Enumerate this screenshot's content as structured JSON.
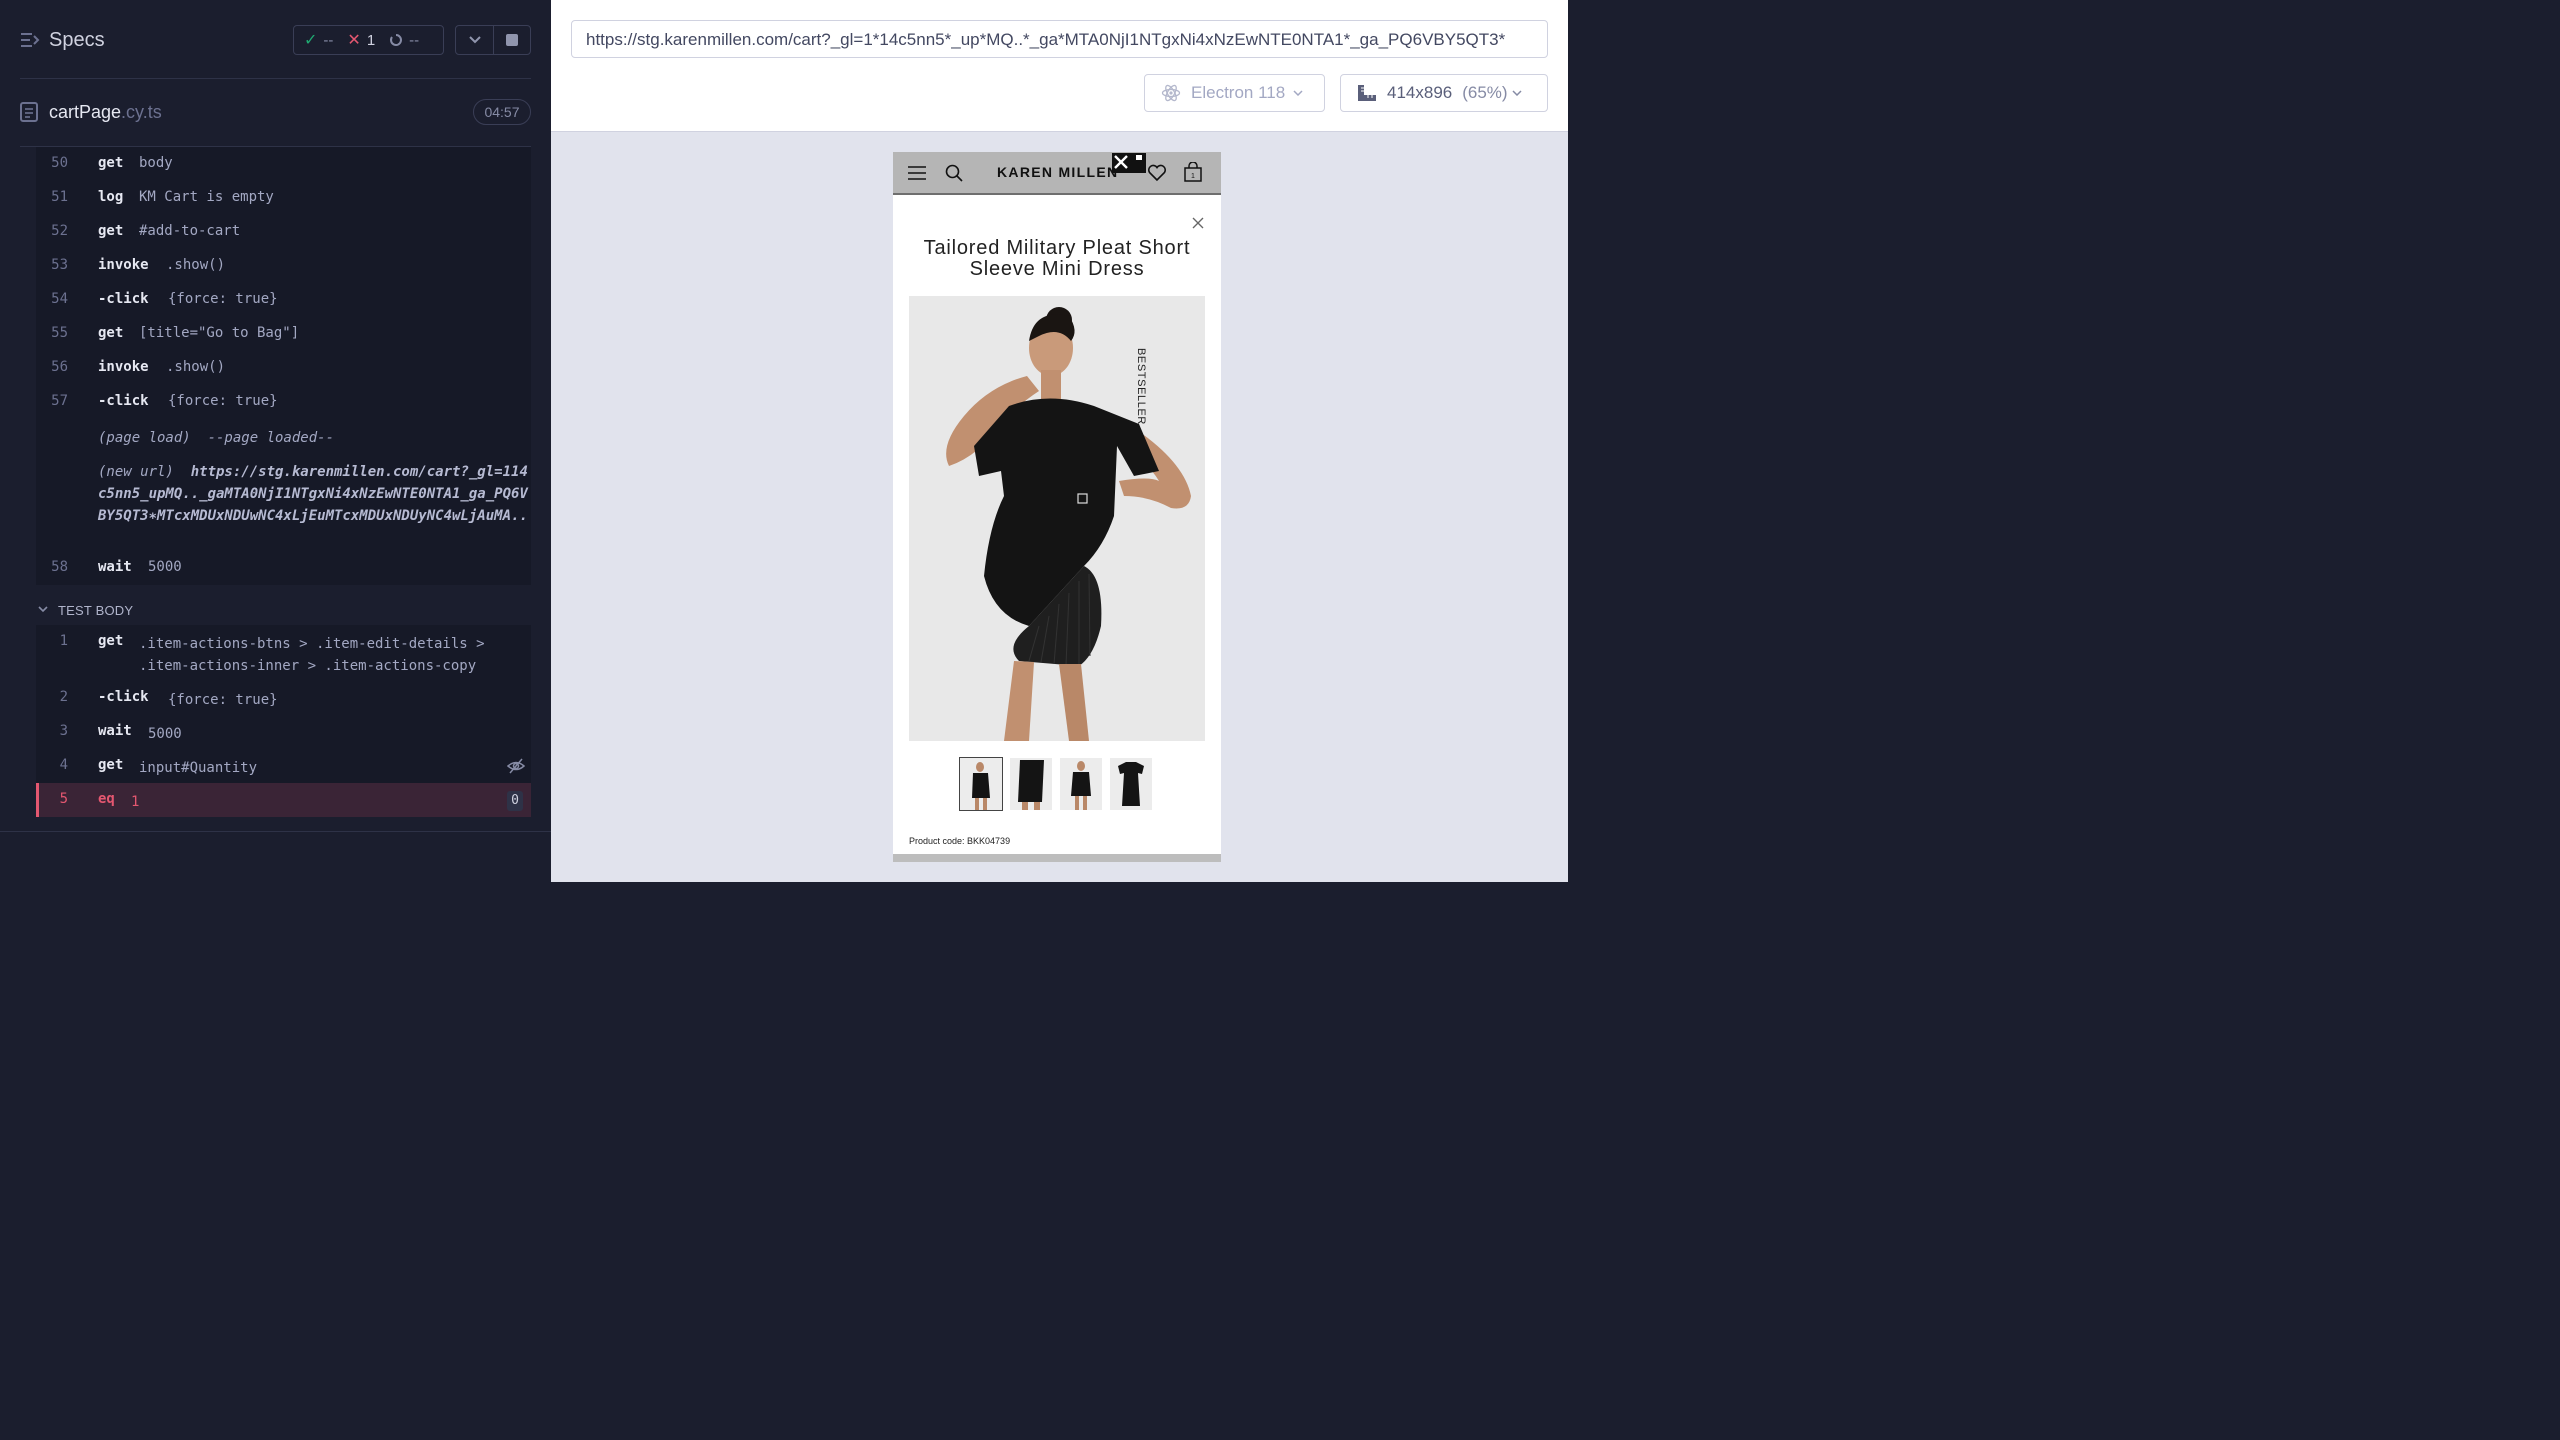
{
  "specs": {
    "title": "Specs",
    "passed": "--",
    "failed": "1",
    "pending": "--"
  },
  "file": {
    "name": "cartPage",
    "ext": ".cy.ts",
    "duration": "04:57"
  },
  "commands": [
    {
      "num": "50",
      "name": "get",
      "msg": "body"
    },
    {
      "num": "51",
      "name": "log",
      "msg": "KM Cart is empty"
    },
    {
      "num": "52",
      "name": "get",
      "msg": "#add-to-cart"
    },
    {
      "num": "53",
      "name": "invoke",
      "msg": ".show()"
    },
    {
      "num": "54",
      "name": "-click",
      "msg": "{force: true}"
    },
    {
      "num": "55",
      "name": "get",
      "msg": "[title=\"Go to Bag\"]"
    },
    {
      "num": "56",
      "name": "invoke",
      "msg": ".show()"
    },
    {
      "num": "57",
      "name": "-click",
      "msg": "{force: true}"
    }
  ],
  "page_load": {
    "label": "(page load)",
    "msg": "--page loaded--"
  },
  "new_url": {
    "label": "(new url)",
    "msg": "https://stg.karenmillen.com/cart?_gl=114c5nn5_upMQ.._gaMTA0NjI1NTgxNi4xNzEwNTE0NTA1_ga_PQ6VBY5QT3∗MTcxMDUxNDUwNC4xLjEuMTcxMDUxNDUyNC4wLjAuMA.."
  },
  "command_58": {
    "num": "58",
    "name": "wait",
    "msg": "5000"
  },
  "test_body": {
    "label": "TEST BODY",
    "commands": [
      {
        "num": "1",
        "name": "get",
        "msg": ".item-actions-btns > .item-edit-details > .item-actions-inner > .item-actions-copy"
      },
      {
        "num": "2",
        "name": "-click",
        "msg": "{force: true}"
      },
      {
        "num": "3",
        "name": "wait",
        "msg": "5000"
      },
      {
        "num": "4",
        "name": "get",
        "msg": "input#Quantity"
      },
      {
        "num": "5",
        "name": "eq",
        "msg": "1",
        "count": "0"
      }
    ]
  },
  "browser": {
    "url": "https://stg.karenmillen.com/cart?_gl=1*14c5nn5*_up*MQ..*_ga*MTA0NjI1NTgxNi4xNzEwNTE0NTA1*_ga_PQ6VBY5QT3*",
    "name": "Electron 118",
    "viewport": "414x896",
    "scale": "(65%)"
  },
  "site": {
    "logo": "KAREN MILLEN",
    "bag_count": "1",
    "product_title": "Tailored Military Pleat Short Sleeve Mini Dress",
    "badge": "BESTSELLER",
    "product_code": "Product code: BKK04739"
  },
  "colors": {
    "accent_pass": "#1fa971",
    "accent_fail": "#e45770"
  }
}
